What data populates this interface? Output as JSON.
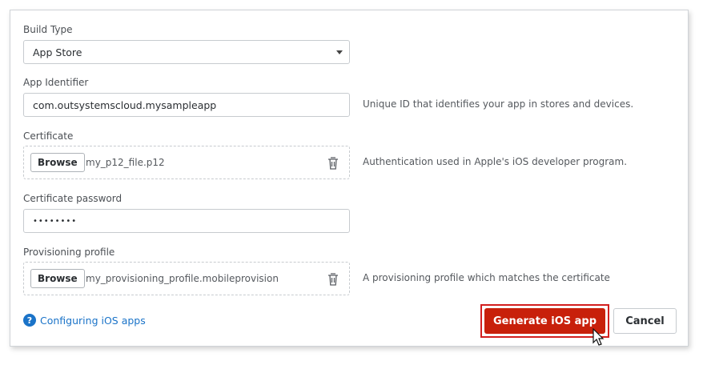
{
  "form": {
    "build_type": {
      "label": "Build Type",
      "value": "App Store"
    },
    "app_identifier": {
      "label": "App Identifier",
      "value": "com.outsystemscloud.mysampleapp",
      "hint": "Unique ID that identifies your app in stores and devices."
    },
    "certificate": {
      "label": "Certificate",
      "browse_label": "Browse",
      "file_name": "my_p12_file.p12",
      "hint": "Authentication used in Apple's iOS developer program."
    },
    "certificate_password": {
      "label": "Certificate password",
      "value": "••••••••"
    },
    "provisioning_profile": {
      "label": "Provisioning profile",
      "browse_label": "Browse",
      "file_name": "my_provisioning_profile.mobileprovision",
      "hint": "A provisioning profile which matches the certificate"
    }
  },
  "footer": {
    "help_link": "Configuring iOS apps",
    "primary_button": "Generate iOS app",
    "cancel_button": "Cancel"
  },
  "colors": {
    "primary": "#c8200a",
    "focus_outline": "#d21f1f",
    "link": "#1a73c8"
  },
  "icons": {
    "trash": "trash-icon",
    "help": "help-circle-icon",
    "caret": "chevron-down-icon",
    "cursor": "mouse-pointer-icon"
  }
}
